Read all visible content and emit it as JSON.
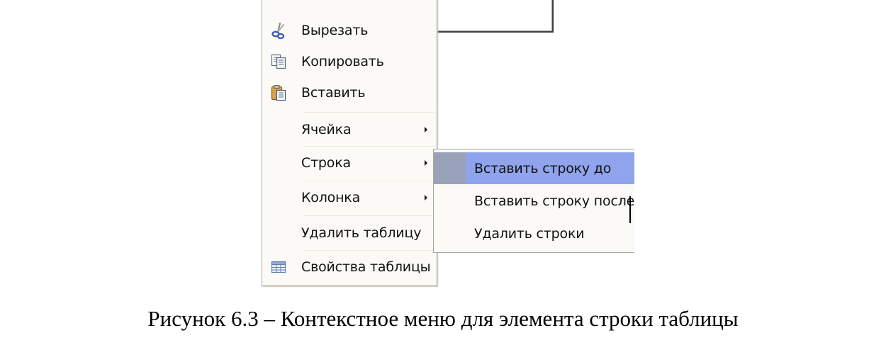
{
  "context_menu": {
    "items": [
      {
        "label": "Вырезать",
        "icon": "cut-scissors-icon"
      },
      {
        "label": "Копировать",
        "icon": "copy-icon"
      },
      {
        "label": "Вставить",
        "icon": "paste-clipboard-icon"
      },
      {
        "label": "Ячейка",
        "has_submenu": true
      },
      {
        "label": "Строка",
        "has_submenu": true
      },
      {
        "label": "Колонка",
        "has_submenu": true
      },
      {
        "label": "Удалить таблицу"
      },
      {
        "label": "Свойства таблицы",
        "icon": "table-properties-icon"
      }
    ]
  },
  "row_submenu": {
    "items": [
      {
        "label": "Вставить строку до",
        "highlighted": true
      },
      {
        "label": "Вставить строку после"
      },
      {
        "label": "Удалить строки"
      }
    ]
  },
  "caption": "Рисунок 6.3 – Контекстное меню для элемента строки таблицы",
  "colors": {
    "menu_background": "#fbfaf6",
    "menu_border": "#a7a79c",
    "highlight": "#8fa4ec",
    "highlight_gutter": "#9aa2b9"
  }
}
